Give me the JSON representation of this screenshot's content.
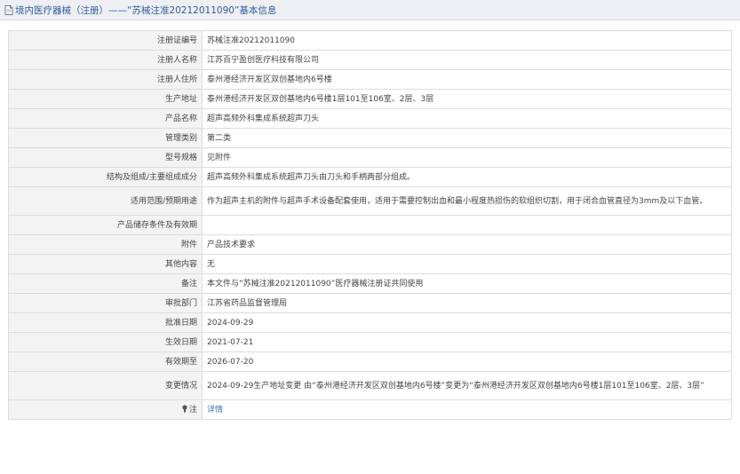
{
  "header": {
    "title": "境内医疗器械（注册）——“苏械注准20212011090”基本信息"
  },
  "fields": [
    {
      "label": "注册证编号",
      "value": "苏械注准20212011090"
    },
    {
      "label": "注册人名称",
      "value": "江苏百宁盈创医疗科技有限公司"
    },
    {
      "label": "注册人住所",
      "value": "泰州港经济开发区双创基地内6号楼"
    },
    {
      "label": "生产地址",
      "value": "泰州港经济开发区双创基地内6号楼1层101至106室、2层、3层"
    },
    {
      "label": "产品名称",
      "value": "超声高频外科集成系统超声刀头"
    },
    {
      "label": "管理类别",
      "value": "第二类"
    },
    {
      "label": "型号规格",
      "value": "见附件"
    },
    {
      "label": "结构及组成/主要组成成分",
      "value": "超声高频外科集成系统超声刀头由刀头和手柄两部分组成。"
    },
    {
      "label": "适用范围/预期用途",
      "value": "作为超声主机的附件与超声手术设备配套使用，适用于需要控制出血和最小程度热损伤的软组织切割，用于闭合血管直径为3mm及以下血管。"
    },
    {
      "label": "产品储存条件及有效期",
      "value": ""
    },
    {
      "label": "附件",
      "value": "产品技术要求"
    },
    {
      "label": "其他内容",
      "value": "无"
    },
    {
      "label": "备注",
      "value": "本文件与“苏械注准20212011090”医疗器械注册证共同使用"
    },
    {
      "label": "审批部门",
      "value": "江苏省药品监督管理局"
    },
    {
      "label": "批准日期",
      "value": "2024-09-29"
    },
    {
      "label": "生效日期",
      "value": "2021-07-21"
    },
    {
      "label": "有效期至",
      "value": "2026-07-20"
    },
    {
      "label": "变更情况",
      "value": "2024-09-29生产地址变更 由“泰州港经济开发区双创基地内6号楼”变更为“泰州港经济开发区双创基地内6号楼1层101至106室、2层、3层”"
    }
  ],
  "note": {
    "label": "注",
    "link_text": "详情",
    "icon": "note-icon"
  },
  "colors": {
    "header_text": "#2d5c9c",
    "link": "#3a72c2",
    "label_bg": "#f3f3f3",
    "border": "#dcdcdc"
  }
}
